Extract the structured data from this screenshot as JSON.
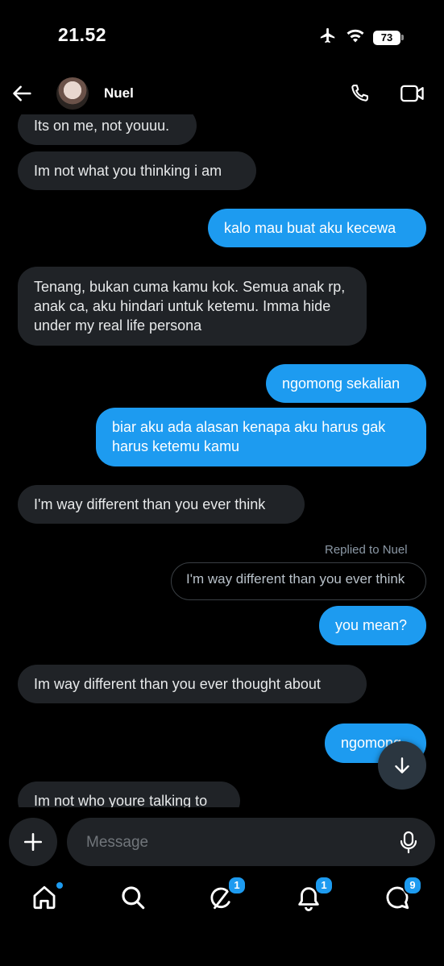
{
  "status_bar": {
    "time": "21.52",
    "battery": "73"
  },
  "header": {
    "contact_name": "Nuel"
  },
  "messages": [
    {
      "side": "in",
      "text": "Its on me, not youuu."
    },
    {
      "side": "in",
      "text": "Im not what you thinking i am"
    },
    {
      "side": "out",
      "text": "kalo mau buat aku kecewa"
    },
    {
      "side": "in",
      "text": "Tenang, bukan cuma kamu kok. Semua anak rp, anak ca, aku hindari untuk ketemu. Imma hide under my real life persona"
    },
    {
      "side": "out",
      "text": "ngomong sekalian"
    },
    {
      "side": "out",
      "text": "biar aku ada alasan kenapa aku harus gak harus ketemu kamu"
    },
    {
      "side": "in",
      "text": "I'm way different than you ever think"
    },
    {
      "side": "out",
      "text": "you mean?"
    },
    {
      "side": "in",
      "text": "Im way different than you ever thought about"
    },
    {
      "side": "out",
      "text": "ngomong"
    },
    {
      "side": "in",
      "text": "Im not who youre talking to"
    }
  ],
  "reply": {
    "label": "Replied to Nuel",
    "quoted": "I'm way different than you ever think"
  },
  "composer": {
    "placeholder": "Message"
  },
  "nav": {
    "items": [
      {
        "icon": "home-icon",
        "badge": ""
      },
      {
        "icon": "search-icon",
        "badge": ""
      },
      {
        "icon": "grok-icon",
        "badge": "1"
      },
      {
        "icon": "bell-icon",
        "badge": "1"
      },
      {
        "icon": "messages-icon",
        "badge": "9"
      }
    ]
  },
  "colors": {
    "accent": "#1d9bf0",
    "incoming_bubble": "#202327",
    "background": "#000000"
  }
}
